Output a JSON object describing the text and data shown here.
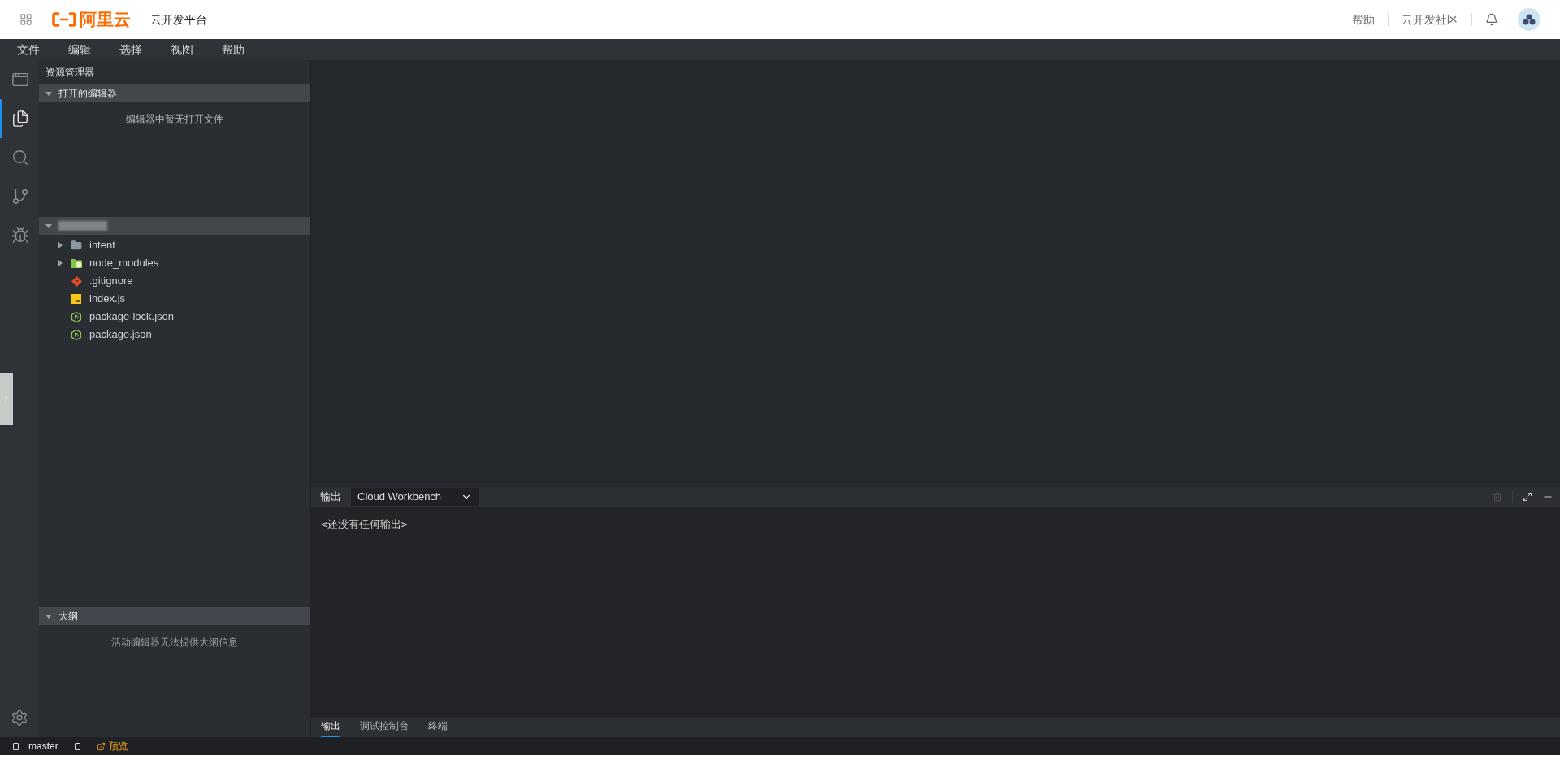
{
  "header": {
    "logo_text": "阿里云",
    "product": "云开发平台",
    "links": [
      "帮助",
      "云开发社区"
    ]
  },
  "menu": [
    "文件",
    "编辑",
    "选择",
    "视图",
    "帮助"
  ],
  "activity_bar": [
    {
      "kind": "home",
      "selected": false
    },
    {
      "kind": "files",
      "selected": true
    },
    {
      "kind": "search",
      "selected": false
    },
    {
      "kind": "git",
      "selected": false
    },
    {
      "kind": "debug",
      "selected": false
    }
  ],
  "sidebar": {
    "title": "资源管理器",
    "open_editors": {
      "title": "打开的编辑器",
      "expanded": true,
      "message": "编辑器中暂无打开文件"
    },
    "project": {
      "expanded": true,
      "files": [
        {
          "name": "intent",
          "kind": "folder",
          "expanded": false
        },
        {
          "name": "node_modules",
          "kind": "modules",
          "expanded": false
        },
        {
          "name": ".gitignore",
          "kind": "git"
        },
        {
          "name": "index.js",
          "kind": "js"
        },
        {
          "name": "package-lock.json",
          "kind": "node"
        },
        {
          "name": "package.json",
          "kind": "node"
        }
      ]
    },
    "outline": {
      "title": "大纲",
      "expanded": true,
      "message": "活动编辑器无法提供大纲信息"
    }
  },
  "output_panel": {
    "label": "输出",
    "channel": "Cloud Workbench",
    "text": "<还没有任何输出>"
  },
  "bottom_tabs": [
    {
      "label": "输出",
      "selected": true
    },
    {
      "label": "调试控制台",
      "selected": false
    },
    {
      "label": "终端",
      "selected": false
    }
  ],
  "status_bar": {
    "branch": "master",
    "preview": "预览"
  }
}
